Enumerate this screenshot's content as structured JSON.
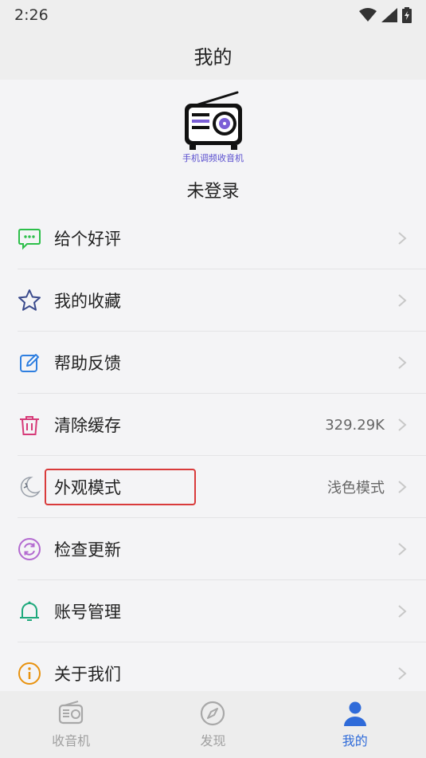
{
  "status": {
    "time": "2:26"
  },
  "header": {
    "title": "我的"
  },
  "profile": {
    "logo_caption": "手机调频收音机",
    "login_text": "未登录"
  },
  "menu": [
    {
      "label": "给个好评",
      "icon": "message-icon",
      "value": ""
    },
    {
      "label": "我的收藏",
      "icon": "star-icon",
      "value": ""
    },
    {
      "label": "帮助反馈",
      "icon": "edit-icon",
      "value": ""
    },
    {
      "label": "清除缓存",
      "icon": "trash-icon",
      "value": "329.29K"
    },
    {
      "label": "外观模式",
      "icon": "moon-icon",
      "value": "浅色模式"
    },
    {
      "label": "检查更新",
      "icon": "refresh-icon",
      "value": ""
    },
    {
      "label": "账号管理",
      "icon": "bell-icon",
      "value": ""
    },
    {
      "label": "关于我们",
      "icon": "info-icon",
      "value": ""
    }
  ],
  "tabs": [
    {
      "label": "收音机",
      "icon": "radio-icon",
      "active": false
    },
    {
      "label": "发现",
      "icon": "compass-icon",
      "active": false
    },
    {
      "label": "我的",
      "icon": "user-icon",
      "active": true
    }
  ],
  "colors": {
    "accent": "#2f6bd9",
    "highlight_border": "#d93b3b"
  }
}
